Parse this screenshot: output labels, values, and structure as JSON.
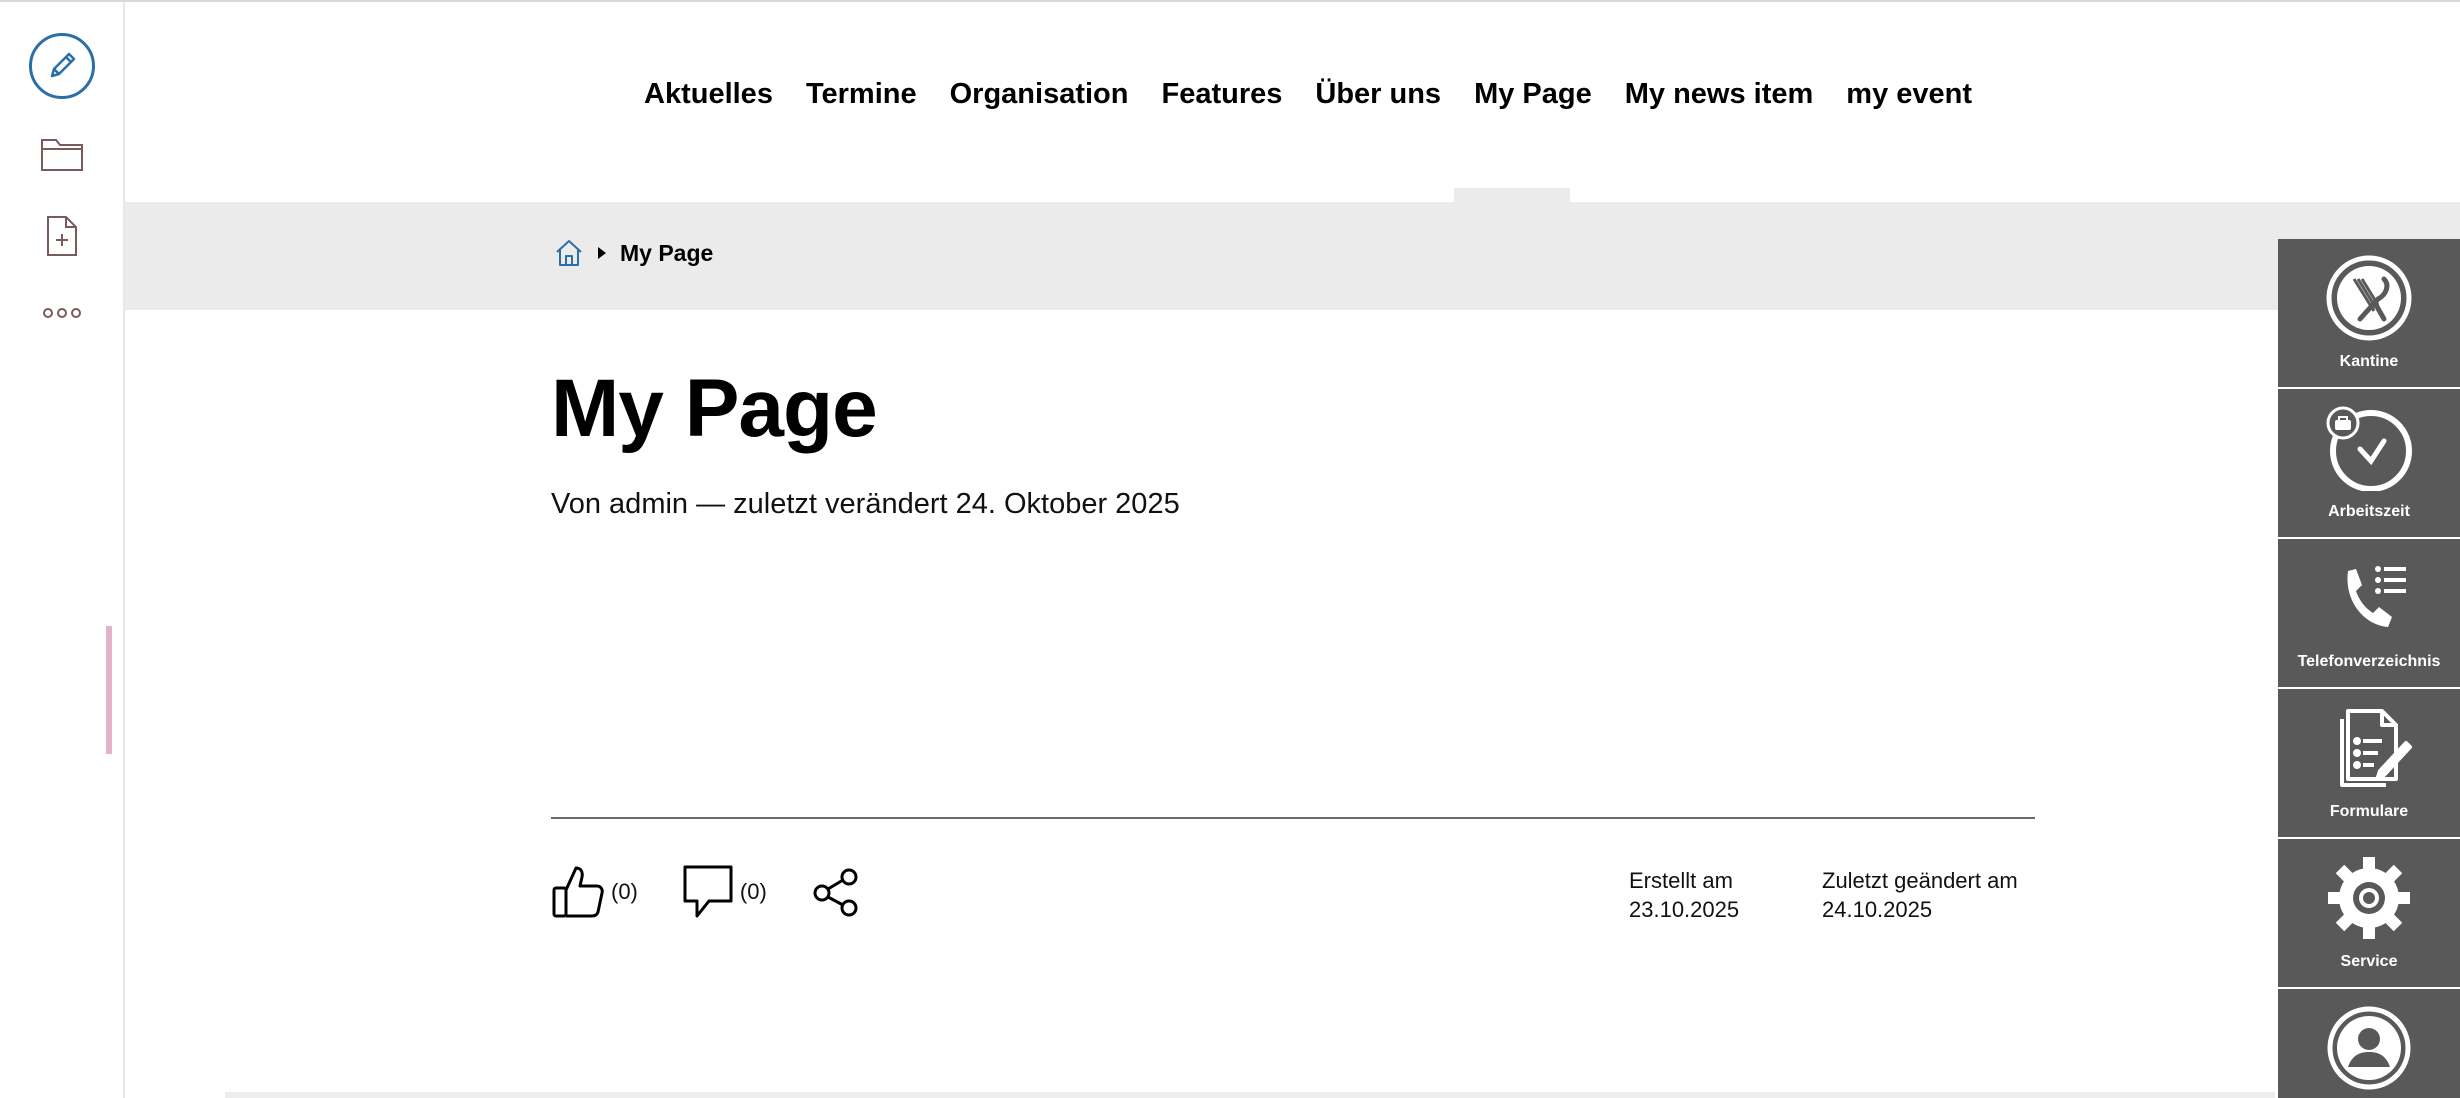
{
  "toolbar": {
    "icons": [
      "pencil-icon",
      "folder-icon",
      "add-document-icon",
      "more-icon"
    ]
  },
  "nav": {
    "items": [
      {
        "label": "Aktuelles"
      },
      {
        "label": "Termine"
      },
      {
        "label": "Organisation"
      },
      {
        "label": "Features"
      },
      {
        "label": "Über uns"
      },
      {
        "label": "My Page"
      },
      {
        "label": "My news item"
      },
      {
        "label": "my event"
      }
    ],
    "active": "My Page"
  },
  "breadcrumb": {
    "home_icon": "home-icon",
    "current": "My Page"
  },
  "page": {
    "title": "My Page",
    "byline": "Von admin — zuletzt verändert 24. Oktober 2025"
  },
  "actions": {
    "likes": "(0)",
    "comments": "(0)"
  },
  "meta": {
    "created_label": "Erstellt am",
    "created_date": "23.10.2025",
    "changed_label": "Zuletzt geändert am",
    "changed_date": "24.10.2025"
  },
  "quicklinks": [
    {
      "label": "Kantine",
      "icon": "cutlery-icon"
    },
    {
      "label": "Arbeitszeit",
      "icon": "clock-icon"
    },
    {
      "label": "Telefonverzeichnis",
      "icon": "phone-list-icon"
    },
    {
      "label": "Formulare",
      "icon": "form-icon"
    },
    {
      "label": "Service",
      "icon": "gear-icon"
    },
    {
      "label": "",
      "icon": "user-icon"
    }
  ],
  "colors": {
    "accent": "#2a6fa8",
    "panel": "#595959",
    "band": "#ebebeb"
  }
}
